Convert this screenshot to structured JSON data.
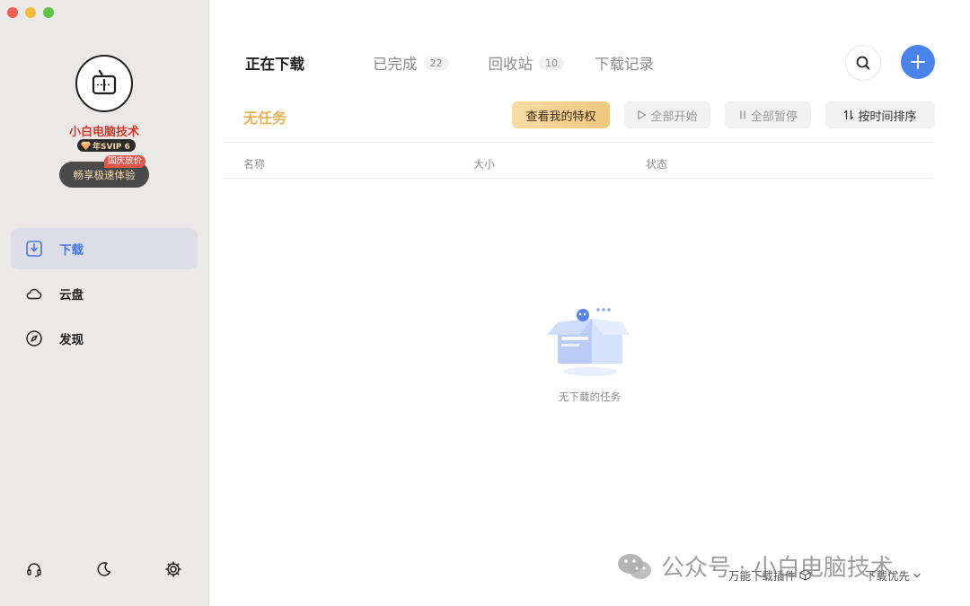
{
  "sidebar": {
    "username": "小白电脑技术",
    "vip_badge": "年SVIP 6",
    "promo_tag": "国庆放价",
    "promo_button": "畅享极速体验",
    "nav": [
      {
        "label": "下载",
        "icon": "download-icon"
      },
      {
        "label": "云盘",
        "icon": "cloud-icon"
      },
      {
        "label": "发现",
        "icon": "compass-icon"
      }
    ],
    "bottom_icons": [
      "headset-icon",
      "moon-icon",
      "gear-icon"
    ]
  },
  "tabs": [
    {
      "label": "正在下载"
    },
    {
      "label": "已完成",
      "count": "22"
    },
    {
      "label": "回收站",
      "count": "10"
    },
    {
      "label": "下载记录"
    }
  ],
  "toolbar": {
    "status": "无任务",
    "privilege": "查看我的特权",
    "start_all": "全部开始",
    "pause_all": "全部暂停",
    "sort": "按时间排序"
  },
  "columns": [
    "名称",
    "大小",
    "状态"
  ],
  "empty_text": "无下载的任务",
  "footer": {
    "plugin": "万能下载插件",
    "priority": "下载优先"
  },
  "watermark": "公众号 · 小白电脑技术",
  "colors": {
    "accent": "#4b83ec",
    "active_nav": "#4a77e0",
    "username": "#d0392b",
    "status": "#e7b35a"
  }
}
